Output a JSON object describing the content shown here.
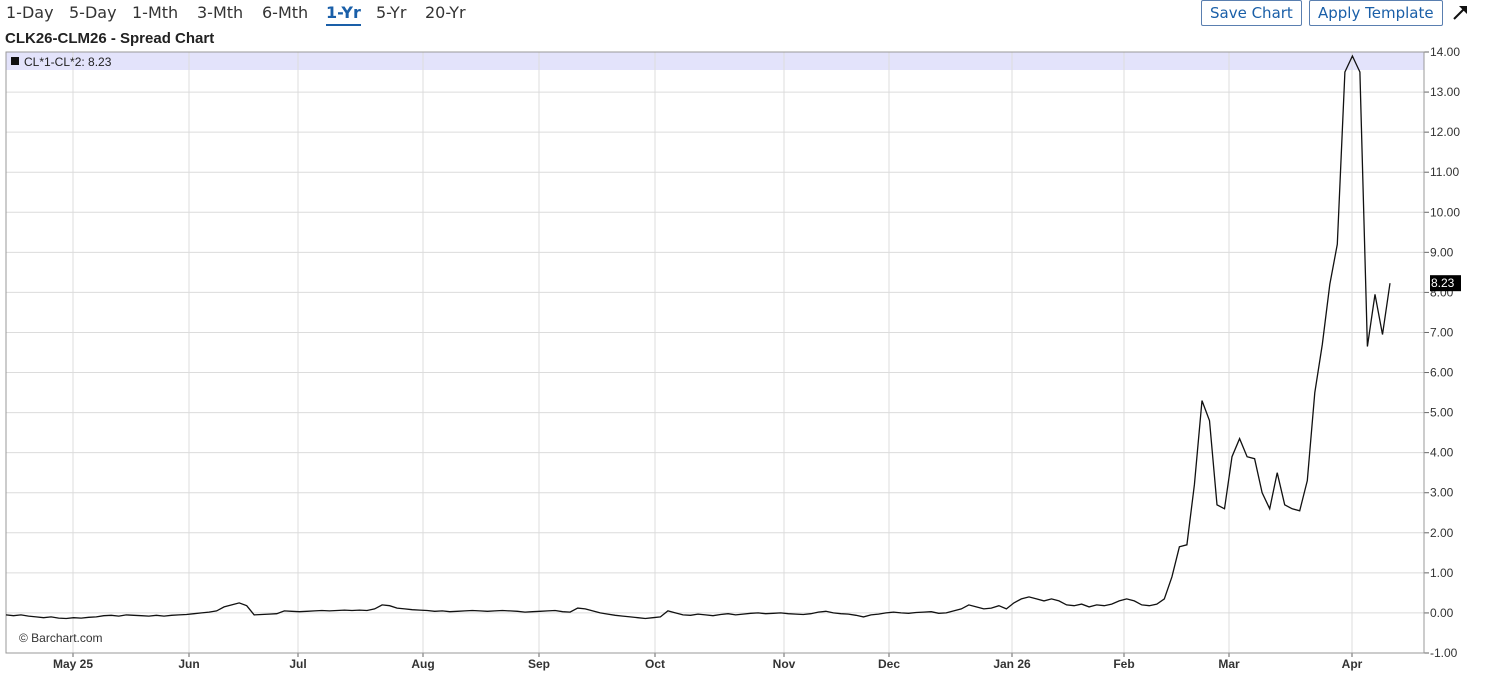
{
  "toolbar": {
    "ranges": [
      "1-Day",
      "5-Day",
      "1-Mth",
      "3-Mth",
      "6-Mth",
      "1-Yr",
      "5-Yr",
      "20-Yr"
    ],
    "active_range": "1-Yr",
    "save_label": "Save Chart",
    "template_label": "Apply Template",
    "expand_icon": "expand-arrow-icon"
  },
  "chart_title": "CLK26-CLM26 - Spread Chart",
  "chart_data": {
    "type": "line",
    "legend": "CL*1-CL*2: 8.23",
    "last_value_label": "8.23",
    "watermark": "© Barchart.com",
    "ylim": [
      -1.0,
      14.0
    ],
    "yticks": [
      "14.00",
      "13.00",
      "12.00",
      "11.00",
      "10.00",
      "9.00",
      "8.00",
      "7.00",
      "6.00",
      "5.00",
      "4.00",
      "3.00",
      "2.00",
      "1.00",
      "0.00",
      "-1.00"
    ],
    "xticks": [
      "May 25",
      "Jun",
      "Jul",
      "Aug",
      "Sep",
      "Oct",
      "Nov",
      "Dec",
      "Jan 26",
      "Feb",
      "Mar",
      "Apr"
    ],
    "grid": true,
    "series": [
      {
        "values": [
          -0.05,
          -0.07,
          -0.05,
          -0.08,
          -0.1,
          -0.12,
          -0.1,
          -0.13,
          -0.14,
          -0.12,
          -0.13,
          -0.11,
          -0.1,
          -0.07,
          -0.06,
          -0.08,
          -0.05,
          -0.06,
          -0.07,
          -0.08,
          -0.06,
          -0.08,
          -0.06,
          -0.05,
          -0.04,
          -0.02,
          0.0,
          0.02,
          0.05,
          0.15,
          0.2,
          0.25,
          0.18,
          -0.05,
          -0.04,
          -0.03,
          -0.02,
          0.05,
          0.04,
          0.03,
          0.04,
          0.05,
          0.06,
          0.05,
          0.06,
          0.07,
          0.06,
          0.07,
          0.06,
          0.1,
          0.2,
          0.18,
          0.12,
          0.1,
          0.08,
          0.07,
          0.06,
          0.04,
          0.05,
          0.03,
          0.04,
          0.05,
          0.06,
          0.05,
          0.04,
          0.05,
          0.06,
          0.05,
          0.04,
          0.02,
          0.03,
          0.04,
          0.05,
          0.06,
          0.03,
          0.02,
          0.12,
          0.1,
          0.05,
          0.0,
          -0.03,
          -0.06,
          -0.08,
          -0.1,
          -0.12,
          -0.14,
          -0.12,
          -0.1,
          0.05,
          0.0,
          -0.05,
          -0.06,
          -0.03,
          -0.05,
          -0.07,
          -0.04,
          -0.02,
          -0.05,
          -0.03,
          -0.01,
          0.0,
          -0.02,
          -0.01,
          0.0,
          -0.02,
          -0.03,
          -0.04,
          -0.02,
          0.02,
          0.04,
          0.0,
          -0.02,
          -0.03,
          -0.06,
          -0.1,
          -0.05,
          -0.03,
          0.0,
          0.02,
          0.0,
          -0.01,
          0.01,
          0.02,
          0.03,
          -0.01,
          0.0,
          0.05,
          0.1,
          0.2,
          0.15,
          0.1,
          0.12,
          0.18,
          0.1,
          0.25,
          0.35,
          0.4,
          0.35,
          0.3,
          0.35,
          0.3,
          0.2,
          0.18,
          0.22,
          0.15,
          0.2,
          0.18,
          0.22,
          0.3,
          0.35,
          0.3,
          0.2,
          0.18,
          0.22,
          0.35,
          0.9,
          1.65,
          1.7,
          3.2,
          5.3,
          4.8,
          2.7,
          2.6,
          3.9,
          4.35,
          3.9,
          3.85,
          3.0,
          2.6,
          3.5,
          2.7,
          2.6,
          2.55,
          3.3,
          5.5,
          6.7,
          8.2,
          9.2,
          13.5,
          13.9,
          13.5,
          6.65,
          7.95,
          6.95,
          8.23
        ]
      }
    ]
  }
}
